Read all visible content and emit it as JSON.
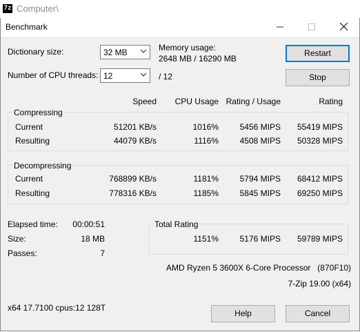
{
  "background_window": {
    "title": "Computer\\",
    "icon_text": "7z"
  },
  "window": {
    "title": "Benchmark"
  },
  "settings": {
    "dictionary_label": "Dictionary size:",
    "dictionary_value": "32 MB",
    "threads_label": "Number of CPU threads:",
    "threads_value": "12",
    "threads_total": "/ 12",
    "memory_label": "Memory usage:",
    "memory_value": "2648 MB / 16290 MB"
  },
  "buttons": {
    "restart": "Restart",
    "stop": "Stop",
    "help": "Help",
    "cancel": "Cancel"
  },
  "columns": {
    "speed": "Speed",
    "cpu_usage": "CPU Usage",
    "rating_usage": "Rating / Usage",
    "rating": "Rating"
  },
  "compressing": {
    "label": "Compressing",
    "rows": [
      {
        "label": "Current",
        "speed": "51201 KB/s",
        "cpu": "1016%",
        "rating_usage": "5456 MIPS",
        "rating": "55419 MIPS"
      },
      {
        "label": "Resulting",
        "speed": "44079 KB/s",
        "cpu": "1116%",
        "rating_usage": "4508 MIPS",
        "rating": "50328 MIPS"
      }
    ]
  },
  "decompressing": {
    "label": "Decompressing",
    "rows": [
      {
        "label": "Current",
        "speed": "768899 KB/s",
        "cpu": "1181%",
        "rating_usage": "5794 MIPS",
        "rating": "68412 MIPS"
      },
      {
        "label": "Resulting",
        "speed": "778316 KB/s",
        "cpu": "1185%",
        "rating_usage": "5845 MIPS",
        "rating": "69250 MIPS"
      }
    ]
  },
  "stats": {
    "elapsed_label": "Elapsed time:",
    "elapsed_value": "00:00:51",
    "size_label": "Size:",
    "size_value": "18 MB",
    "passes_label": "Passes:",
    "passes_value": "7"
  },
  "total": {
    "label": "Total Rating",
    "cpu": "1151%",
    "rating_usage": "5176 MIPS",
    "rating": "59789 MIPS"
  },
  "system": {
    "cpu_name": "AMD Ryzen 5 3600X 6-Core Processor",
    "cpu_id": "(870F10)",
    "version": "7-Zip 19.00 (x64)",
    "arch": "x64 17.7100 cpus:12 128T"
  }
}
